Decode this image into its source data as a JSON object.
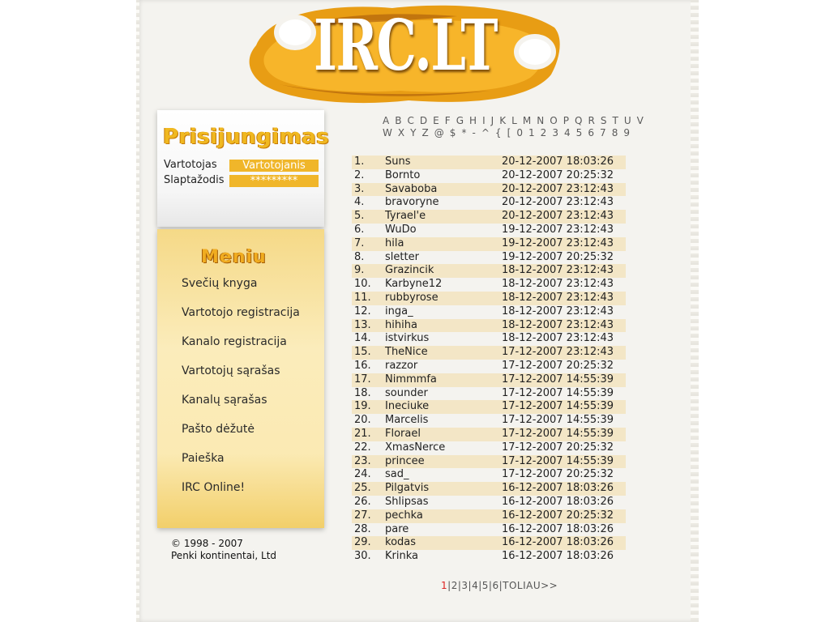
{
  "logo": {
    "text": "IRC.LT"
  },
  "login": {
    "title": "Prisijungimas",
    "user_label": "Vartotojas",
    "user_value": "Vartotojanis",
    "pass_label": "Slaptažodis",
    "pass_value": "*********"
  },
  "menu": {
    "title": "Meniu",
    "items": [
      "Svečių knyga",
      "Vartotojo registracija",
      "Kanalo registracija",
      "Vartotojų sąrašas",
      "Kanalų sąrašas",
      "Pašto dėžutė",
      "Paieška",
      "IRC Online!"
    ]
  },
  "footer": {
    "copyright": "© 1998 - 2007",
    "company": "Penki kontinentai, Ltd"
  },
  "alphabet": {
    "row1": [
      "A",
      "B",
      "C",
      "D",
      "E",
      "F",
      "G",
      "H",
      "I",
      "J",
      "K",
      "L",
      "M",
      "N",
      "O",
      "P",
      "Q",
      "R",
      "S",
      "T",
      "U",
      "V"
    ],
    "row2": [
      "W",
      "X",
      "Y",
      "Z",
      "@",
      "$",
      "*",
      "-",
      "^",
      "{",
      "[",
      "0",
      "1",
      "2",
      "3",
      "4",
      "5",
      "6",
      "7",
      "8",
      "9"
    ]
  },
  "users": [
    {
      "n": "1.",
      "name": "Suns",
      "date": "20-12-2007 18:03:26"
    },
    {
      "n": "2.",
      "name": "Bornto",
      "date": "20-12-2007 20:25:32"
    },
    {
      "n": "3.",
      "name": "Savaboba",
      "date": "20-12-2007 23:12:43"
    },
    {
      "n": "4.",
      "name": "bravoryne",
      "date": "20-12-2007 23:12:43"
    },
    {
      "n": "5.",
      "name": "Tyrael'e",
      "date": "20-12-2007 23:12:43"
    },
    {
      "n": "6.",
      "name": "WuDo",
      "date": "19-12-2007 23:12:43"
    },
    {
      "n": "7.",
      "name": "hila",
      "date": "19-12-2007 23:12:43"
    },
    {
      "n": "8.",
      "name": "sletter",
      "date": "19-12-2007 20:25:32"
    },
    {
      "n": "9.",
      "name": "Grazincik",
      "date": "18-12-2007 23:12:43"
    },
    {
      "n": "10.",
      "name": "Karbyne12",
      "date": "18-12-2007 23:12:43"
    },
    {
      "n": "11.",
      "name": "rubbyrose",
      "date": "18-12-2007 23:12:43"
    },
    {
      "n": "12.",
      "name": "inga_",
      "date": "18-12-2007 23:12:43"
    },
    {
      "n": "13.",
      "name": "hihiha",
      "date": "18-12-2007 23:12:43"
    },
    {
      "n": "14.",
      "name": "istvirkus",
      "date": "18-12-2007 23:12:43"
    },
    {
      "n": "15.",
      "name": "TheNice",
      "date": "17-12-2007 23:12:43"
    },
    {
      "n": "16.",
      "name": "razzor",
      "date": "17-12-2007 20:25:32"
    },
    {
      "n": "17.",
      "name": "Nimmmfa",
      "date": "17-12-2007 14:55:39"
    },
    {
      "n": "18.",
      "name": "sounder",
      "date": "17-12-2007 14:55:39"
    },
    {
      "n": "19.",
      "name": "Ineciuke",
      "date": "17-12-2007 14:55:39"
    },
    {
      "n": "20.",
      "name": "Marcelis",
      "date": "17-12-2007 14:55:39"
    },
    {
      "n": "21.",
      "name": "Florael",
      "date": "17-12-2007 14:55:39"
    },
    {
      "n": "22.",
      "name": "XmasNerce",
      "date": "17-12-2007 20:25:32"
    },
    {
      "n": "23.",
      "name": "princee",
      "date": "17-12-2007 14:55:39"
    },
    {
      "n": "24.",
      "name": "sad_",
      "date": "17-12-2007 20:25:32"
    },
    {
      "n": "25.",
      "name": "Pilgatvis",
      "date": "16-12-2007 18:03:26"
    },
    {
      "n": "26.",
      "name": "Shlipsas",
      "date": "16-12-2007 18:03:26"
    },
    {
      "n": "27.",
      "name": "pechka",
      "date": "16-12-2007 20:25:32"
    },
    {
      "n": "28.",
      "name": "pare",
      "date": "16-12-2007 18:03:26"
    },
    {
      "n": "29.",
      "name": "kodas",
      "date": "16-12-2007 18:03:26"
    },
    {
      "n": "30.",
      "name": "Krinka",
      "date": "16-12-2007 18:03:26"
    }
  ],
  "pager": {
    "current": "1",
    "pages": [
      "2",
      "3",
      "4",
      "5",
      "6"
    ],
    "next": "TOLIAU>>"
  },
  "colors": {
    "accent": "#f0b62a",
    "row_stripe": "#f3e6c6",
    "pager_current": "#dd2222"
  }
}
